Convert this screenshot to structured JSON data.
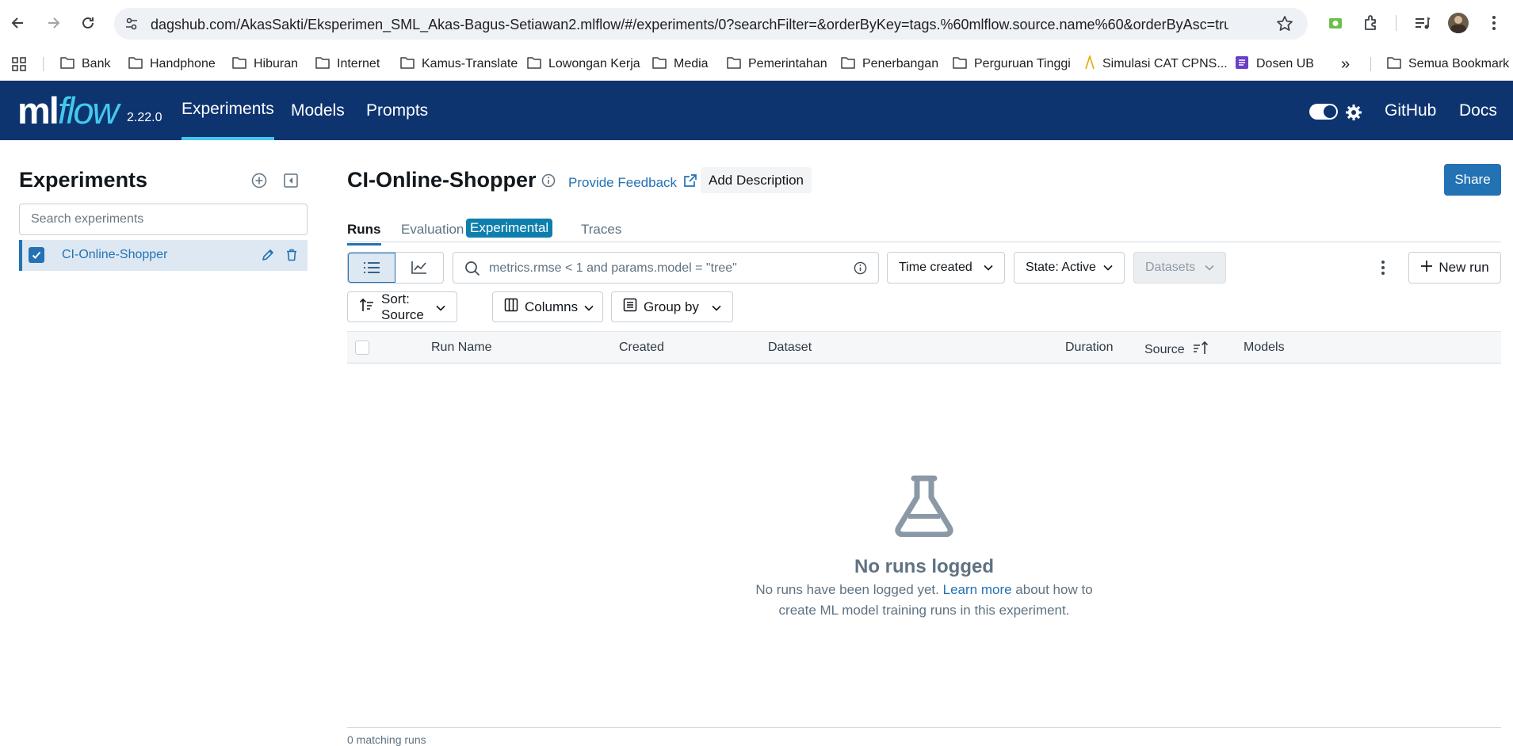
{
  "browser": {
    "url": "dagshub.com/AkasSakti/Eksperimen_SML_Akas-Bagus-Setiawan2.mlflow/#/experiments/0?searchFilter=&orderByKey=tags.%60mlflow.source.name%60&orderByAsc=true&startTi...",
    "bookmarks": [
      "Bank",
      "Handphone",
      "Hiburan",
      "Internet",
      "Kamus-Translate",
      "Lowongan Kerja",
      "Media",
      "Pemerintahan",
      "Penerbangan",
      "Perguruan Tinggi",
      "Simulasi CAT CPNS...",
      "Dosen UB"
    ],
    "all_bookmarks": "Semua Bookmark",
    "overflow": "»"
  },
  "header": {
    "logo_ml": "ml",
    "logo_flow": "flow",
    "version": "2.22.0",
    "nav": [
      "Experiments",
      "Models",
      "Prompts"
    ],
    "github": "GitHub",
    "docs": "Docs",
    "brand_color": "#0e3470",
    "accent_color": "#43c9ed"
  },
  "sidebar": {
    "title": "Experiments",
    "search_placeholder": "Search experiments",
    "experiments": [
      "CI-Online-Shopper"
    ]
  },
  "main": {
    "title": "CI-Online-Shopper",
    "feedback": "Provide Feedback",
    "add_description": "Add Description",
    "share": "Share",
    "tabs": {
      "runs": "Runs",
      "evaluation": "Evaluation",
      "experimental": "Experimental",
      "traces": "Traces"
    },
    "filter_placeholder": "metrics.rmse < 1 and params.model = \"tree\"",
    "time_created": "Time created",
    "state": "State: Active",
    "datasets": "Datasets",
    "new_run": "New run",
    "sort": "Sort: Source",
    "columns": "Columns",
    "group_by": "Group by",
    "table_headers": {
      "run_name": "Run Name",
      "created": "Created",
      "dataset": "Dataset",
      "duration": "Duration",
      "source": "Source",
      "models": "Models"
    },
    "empty": {
      "title": "No runs logged",
      "desc_before": "No runs have been logged yet.",
      "link": "Learn more",
      "desc_after": "about how to create ML model training runs in this experiment."
    },
    "footer": "0 matching runs"
  }
}
